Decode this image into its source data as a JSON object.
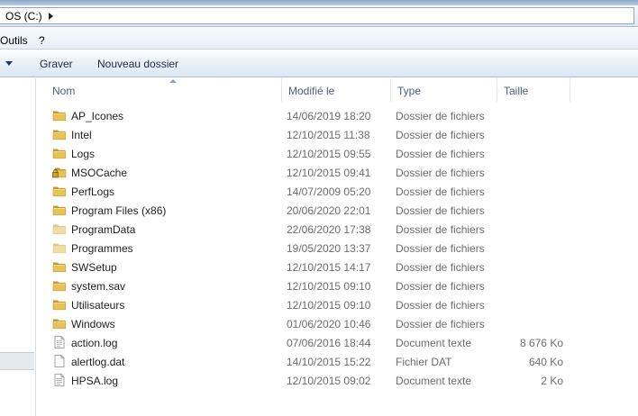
{
  "address": {
    "path": "OS (C:)"
  },
  "menu": {
    "items": [
      "Outils",
      "?"
    ]
  },
  "toolbar": {
    "burn_label": "Graver",
    "new_folder_label": "Nouveau dossier"
  },
  "columns": {
    "name": "Nom",
    "modified": "Modifié le",
    "type": "Type",
    "size": "Taille"
  },
  "files": [
    {
      "name": "AP_Icones",
      "modified": "14/06/2019 18:20",
      "type": "Dossier de fichiers",
      "size": "",
      "icon": "folder-icon"
    },
    {
      "name": "Intel",
      "modified": "12/10/2015 11:38",
      "type": "Dossier de fichiers",
      "size": "",
      "icon": "folder-icon"
    },
    {
      "name": "Logs",
      "modified": "12/10/2015 09:55",
      "type": "Dossier de fichiers",
      "size": "",
      "icon": "folder-icon"
    },
    {
      "name": "MSOCache",
      "modified": "12/10/2015 09:41",
      "type": "Dossier de fichiers",
      "size": "",
      "icon": "locked-folder-icon"
    },
    {
      "name": "PerfLogs",
      "modified": "14/07/2009 05:20",
      "type": "Dossier de fichiers",
      "size": "",
      "icon": "folder-icon"
    },
    {
      "name": "Program Files (x86)",
      "modified": "20/06/2020 22:01",
      "type": "Dossier de fichiers",
      "size": "",
      "icon": "folder-icon"
    },
    {
      "name": "ProgramData",
      "modified": "22/06/2020 17:38",
      "type": "Dossier de fichiers",
      "size": "",
      "icon": "hidden-folder-icon"
    },
    {
      "name": "Programmes",
      "modified": "19/05/2020 13:37",
      "type": "Dossier de fichiers",
      "size": "",
      "icon": "hidden-folder-icon"
    },
    {
      "name": "SWSetup",
      "modified": "12/10/2015 14:17",
      "type": "Dossier de fichiers",
      "size": "",
      "icon": "folder-icon"
    },
    {
      "name": "system.sav",
      "modified": "12/10/2015 09:10",
      "type": "Dossier de fichiers",
      "size": "",
      "icon": "folder-icon"
    },
    {
      "name": "Utilisateurs",
      "modified": "12/10/2015 09:10",
      "type": "Dossier de fichiers",
      "size": "",
      "icon": "folder-icon"
    },
    {
      "name": "Windows",
      "modified": "01/06/2020 10:46",
      "type": "Dossier de fichiers",
      "size": "",
      "icon": "folder-icon"
    },
    {
      "name": "action.log",
      "modified": "07/06/2016 18:44",
      "type": "Document texte",
      "size": "8 676 Ko",
      "icon": "text-file-icon"
    },
    {
      "name": "alertlog.dat",
      "modified": "14/10/2015 15:22",
      "type": "Fichier DAT",
      "size": "640 Ko",
      "icon": "file-icon"
    },
    {
      "name": "HPSA.log",
      "modified": "12/10/2015 09:02",
      "type": "Document texte",
      "size": "2 Ko",
      "icon": "text-file-icon"
    }
  ],
  "colors": {
    "folder": "#e7c25a",
    "folder_dark": "#c99a2a",
    "header_text": "#4c607a",
    "meta_text": "#6d6d6d"
  }
}
